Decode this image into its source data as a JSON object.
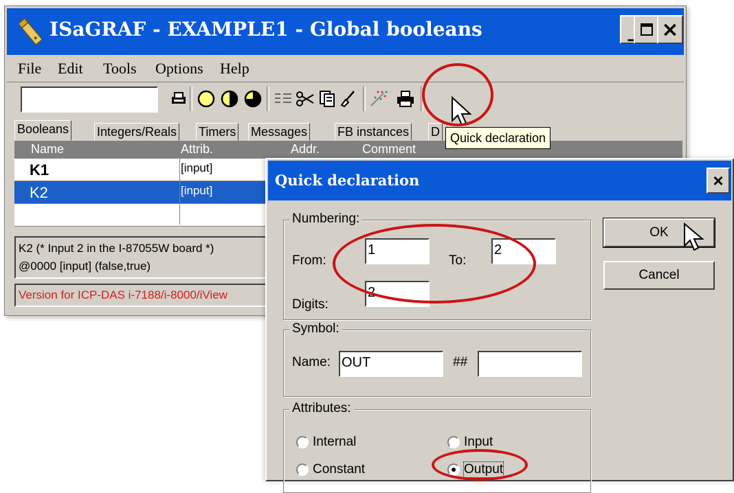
{
  "main_window": {
    "title": "ISaGRAF - EXAMPLE1 - Global booleans",
    "controls": {
      "minimize": "_",
      "maximize": "□",
      "close": "×"
    },
    "menu": [
      "File",
      "Edit",
      "Tools",
      "Options",
      "Help"
    ],
    "tabs": [
      "Booleans",
      "Integers/Reals",
      "Timers",
      "Messages",
      "FB instances",
      "D"
    ],
    "columns": [
      "Name",
      "Attrib.",
      "Addr.",
      "Comment"
    ],
    "rows": [
      {
        "name": "K1",
        "attrib": "[input]"
      },
      {
        "name": "K2",
        "attrib": "[input]"
      }
    ],
    "info_line1": "K2   (* Input 2 in the I-87055W board *)",
    "info_line2": "@0000   [input]   (false,true)",
    "status": "Version for ICP-DAS i-7188/i-8000/iView"
  },
  "tooltip": "Quick declaration",
  "dialog": {
    "title": "Quick declaration",
    "close": "×",
    "numbering": {
      "label": "Numbering:",
      "from_label": "From:",
      "from_value": "1",
      "to_label": "To:",
      "to_value": "2",
      "digits_label": "Digits:",
      "digits_value": "2"
    },
    "symbol": {
      "label": "Symbol:",
      "name_label": "Name:",
      "name_value": "OUT",
      "suffix_label": "##",
      "suffix_value": ""
    },
    "attributes": {
      "label": "Attributes:",
      "options": [
        "Internal",
        "Input",
        "Constant",
        "Output"
      ],
      "selected": "Output"
    },
    "ok_label": "OK",
    "cancel_label": "Cancel"
  },
  "colors": {
    "titlebar": "#0a5ad8",
    "highlight": "#cc1414",
    "selection": "#1c5fc8"
  }
}
